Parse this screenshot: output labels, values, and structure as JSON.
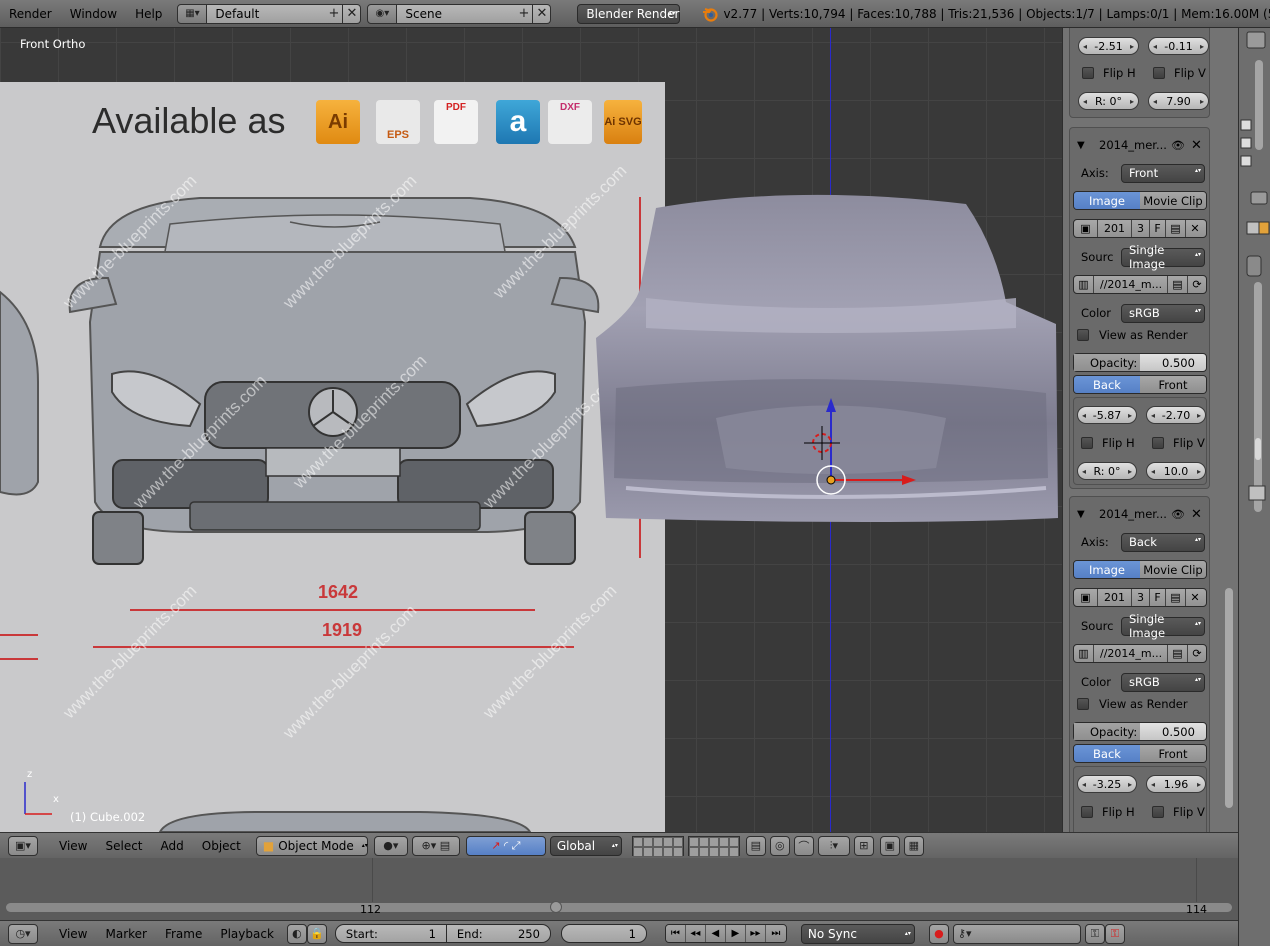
{
  "topbar": {
    "menus": [
      "Render",
      "Window",
      "Help"
    ],
    "layout": "Default",
    "scene": "Scene",
    "engine": "Blender Render",
    "stats": "v2.77 | Verts:10,794 | Faces:10,788 | Tris:21,536 | Objects:1/7 | Lamps:0/1 | Mem:16.00M (5.86M) | Cu"
  },
  "viewport": {
    "view_label": "Front Ortho",
    "object_label": "(1) Cube.002",
    "axis_z": "z",
    "axis_x": "x",
    "blueprint": {
      "heading": "Available as",
      "formats": [
        "Ai",
        "EPS",
        "PDF",
        "a",
        "DXF",
        "Ai SVG"
      ],
      "dim1": "1642",
      "dim2": "1919",
      "watermark": "www.the-blueprints.com"
    }
  },
  "properties": {
    "top_block": {
      "offset_x": "-2.51",
      "offset_y": "-0.11",
      "flip_h": "Flip H",
      "flip_v": "Flip V",
      "rotation": "R: 0°",
      "size": "7.90"
    },
    "blocks": [
      {
        "title": "2014_mer...",
        "axis_label": "Axis:",
        "axis": "Front",
        "tab_image": "Image",
        "tab_movie": "Movie Clip",
        "img_num": "201",
        "img_users": "3",
        "img_fake": "F",
        "source_label": "Sourc",
        "source": "Single Image",
        "path": "//2014_m...",
        "color_label": "Color",
        "color": "sRGB",
        "view_as_render": "View as Render",
        "opacity_label": "Opacity:",
        "opacity": "0.500",
        "opacity_fraction": 0.5,
        "side_back": "Back",
        "side_front": "Front",
        "offset_x": "-5.87",
        "offset_y": "-2.70",
        "flip_h": "Flip H",
        "flip_v": "Flip V",
        "rotation": "R: 0°",
        "size": "10.0"
      },
      {
        "title": "2014_mer...",
        "axis_label": "Axis:",
        "axis": "Back",
        "tab_image": "Image",
        "tab_movie": "Movie Clip",
        "img_num": "201",
        "img_users": "3",
        "img_fake": "F",
        "source_label": "Sourc",
        "source": "Single Image",
        "path": "//2014_m...",
        "color_label": "Color",
        "color": "sRGB",
        "view_as_render": "View as Render",
        "opacity_label": "Opacity:",
        "opacity": "0.500",
        "opacity_fraction": 0.5,
        "side_back": "Back",
        "side_front": "Front",
        "offset_x": "-3.25",
        "offset_y": "1.96",
        "flip_h": "Flip H",
        "flip_v": "Flip V"
      }
    ]
  },
  "view3d_header": {
    "menus": [
      "View",
      "Select",
      "Add",
      "Object"
    ],
    "mode": "Object Mode",
    "orientation": "Global"
  },
  "timeline": {
    "frame_left": "112",
    "frame_right": "114",
    "menus": [
      "View",
      "Marker",
      "Frame",
      "Playback"
    ],
    "start_label": "Start:",
    "start": "1",
    "end_label": "End:",
    "end": "250",
    "current": "1",
    "sync": "No Sync"
  },
  "colors": {
    "accent_blue": "#5680c6",
    "axis_red": "#d81c1c",
    "axis_blue": "#2a2acc",
    "blender_orange": "#e87d0d"
  }
}
